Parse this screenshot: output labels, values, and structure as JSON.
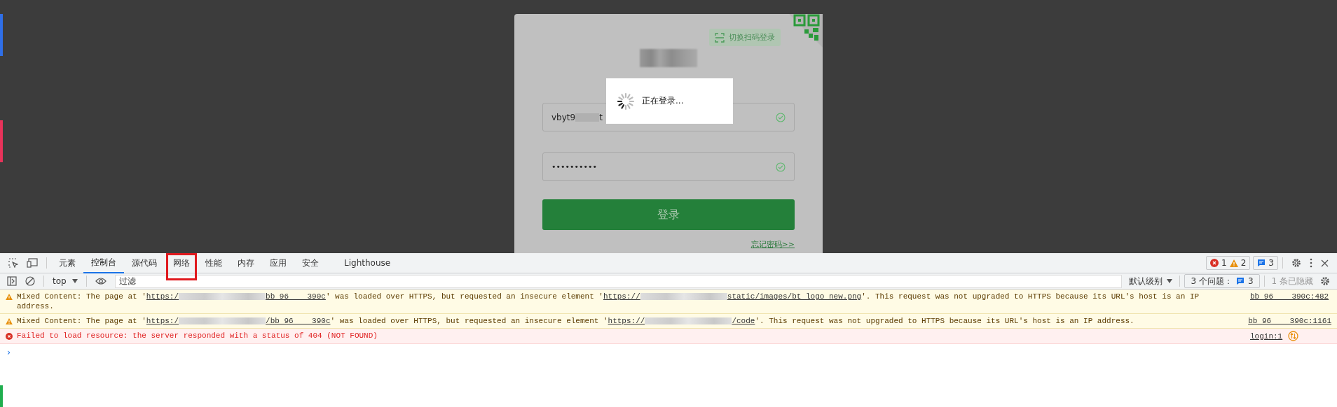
{
  "side_markers": [
    {
      "color": "#2f6fe8"
    },
    {
      "color": "#e8335a"
    },
    {
      "color": "#1fae4e"
    }
  ],
  "login_card": {
    "scan_switch": "切换扫码登录",
    "username": {
      "value_start": "vbyt9",
      "value_end": "t"
    },
    "password": {
      "value": "••••••••••"
    },
    "login_button": "登录",
    "forgot_link": "忘记密码>>"
  },
  "loading_popup": {
    "text": "正在登录..."
  },
  "devtools": {
    "tabs": [
      {
        "label": "元素",
        "selected": false
      },
      {
        "label": "控制台",
        "selected": true
      },
      {
        "label": "源代码",
        "selected": false
      },
      {
        "label": "网络",
        "selected": false,
        "highlighted": true
      },
      {
        "label": "性能",
        "selected": false
      },
      {
        "label": "内存",
        "selected": false
      },
      {
        "label": "应用",
        "selected": false
      },
      {
        "label": "安全",
        "selected": false
      },
      {
        "label": "Lighthouse",
        "selected": false
      }
    ],
    "counts": {
      "errors": "1",
      "warnings": "2",
      "issues": "3"
    },
    "toolbar": {
      "context": "top",
      "filter_placeholder": "过滤",
      "level": "默认级别",
      "issues_label": "3 个问题：",
      "issues_count": "3",
      "hidden": "1 条已隐藏"
    },
    "messages": [
      {
        "kind": "warning",
        "segments": [
          {
            "kind": "text",
            "text": "Mixed Content: The page at '"
          },
          {
            "kind": "link",
            "text": "https:/"
          },
          {
            "kind": "blur"
          },
          {
            "kind": "link",
            "text": "bb 96    390c"
          },
          {
            "kind": "text",
            "text": "' was loaded over HTTPS, but requested an insecure element '"
          },
          {
            "kind": "link",
            "text": "https://"
          },
          {
            "kind": "blur"
          },
          {
            "kind": "link",
            "text": "static/images/bt logo new.png"
          },
          {
            "kind": "text",
            "text": "'. This request was not upgraded to HTTPS because its URL's host is an IP address."
          }
        ],
        "source": "bb 96    390c:482"
      },
      {
        "kind": "warning",
        "segments": [
          {
            "kind": "text",
            "text": "Mixed Content: The page at '"
          },
          {
            "kind": "link",
            "text": "https:/"
          },
          {
            "kind": "blur"
          },
          {
            "kind": "link",
            "text": "/bb 96    390c"
          },
          {
            "kind": "text",
            "text": "' was loaded over HTTPS, but requested an insecure element '"
          },
          {
            "kind": "link",
            "text": "https://"
          },
          {
            "kind": "blur"
          },
          {
            "kind": "link",
            "text": "/code"
          },
          {
            "kind": "text",
            "text": "'. This request was not upgraded to HTTPS because its URL's host is an IP address."
          }
        ],
        "source": "bb 96    390c:1161"
      },
      {
        "kind": "error",
        "segments": [
          {
            "kind": "text",
            "text": "Failed to load resource: the server responded with a status of 404 (NOT FOUND)"
          }
        ],
        "source": "login:1"
      }
    ],
    "prompt": "›"
  }
}
